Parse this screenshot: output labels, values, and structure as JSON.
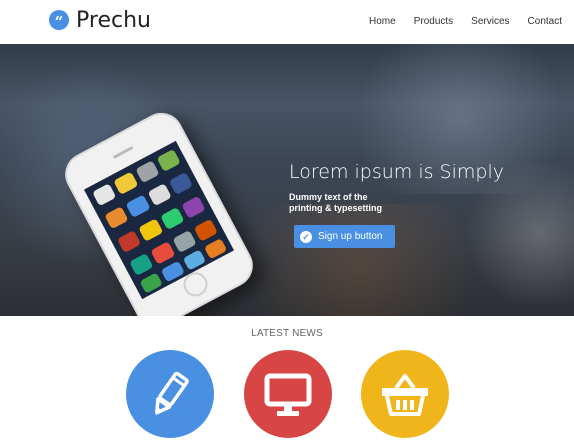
{
  "header": {
    "logo_icon": "quote-icon",
    "brand": "Prechu",
    "nav": [
      "Home",
      "Products",
      "Services",
      "Contact"
    ]
  },
  "hero": {
    "headline": "Lorem ipsum is Simply",
    "subline": [
      "Dummy text of the",
      "printing & typesetting"
    ],
    "cta": {
      "label": "Sign up button",
      "icon": "check-circle-icon"
    },
    "image": "iphone-image"
  },
  "news": {
    "title": "LATEST NEWS",
    "items": [
      {
        "icon": "pencil-icon",
        "color": "#4a90e2"
      },
      {
        "icon": "monitor-icon",
        "color": "#d84545"
      },
      {
        "icon": "shopping-basket-icon",
        "color": "#f0b51a"
      }
    ]
  },
  "colors": {
    "accent": "#4a90e2",
    "red": "#d84545",
    "yellow": "#f0b51a"
  }
}
